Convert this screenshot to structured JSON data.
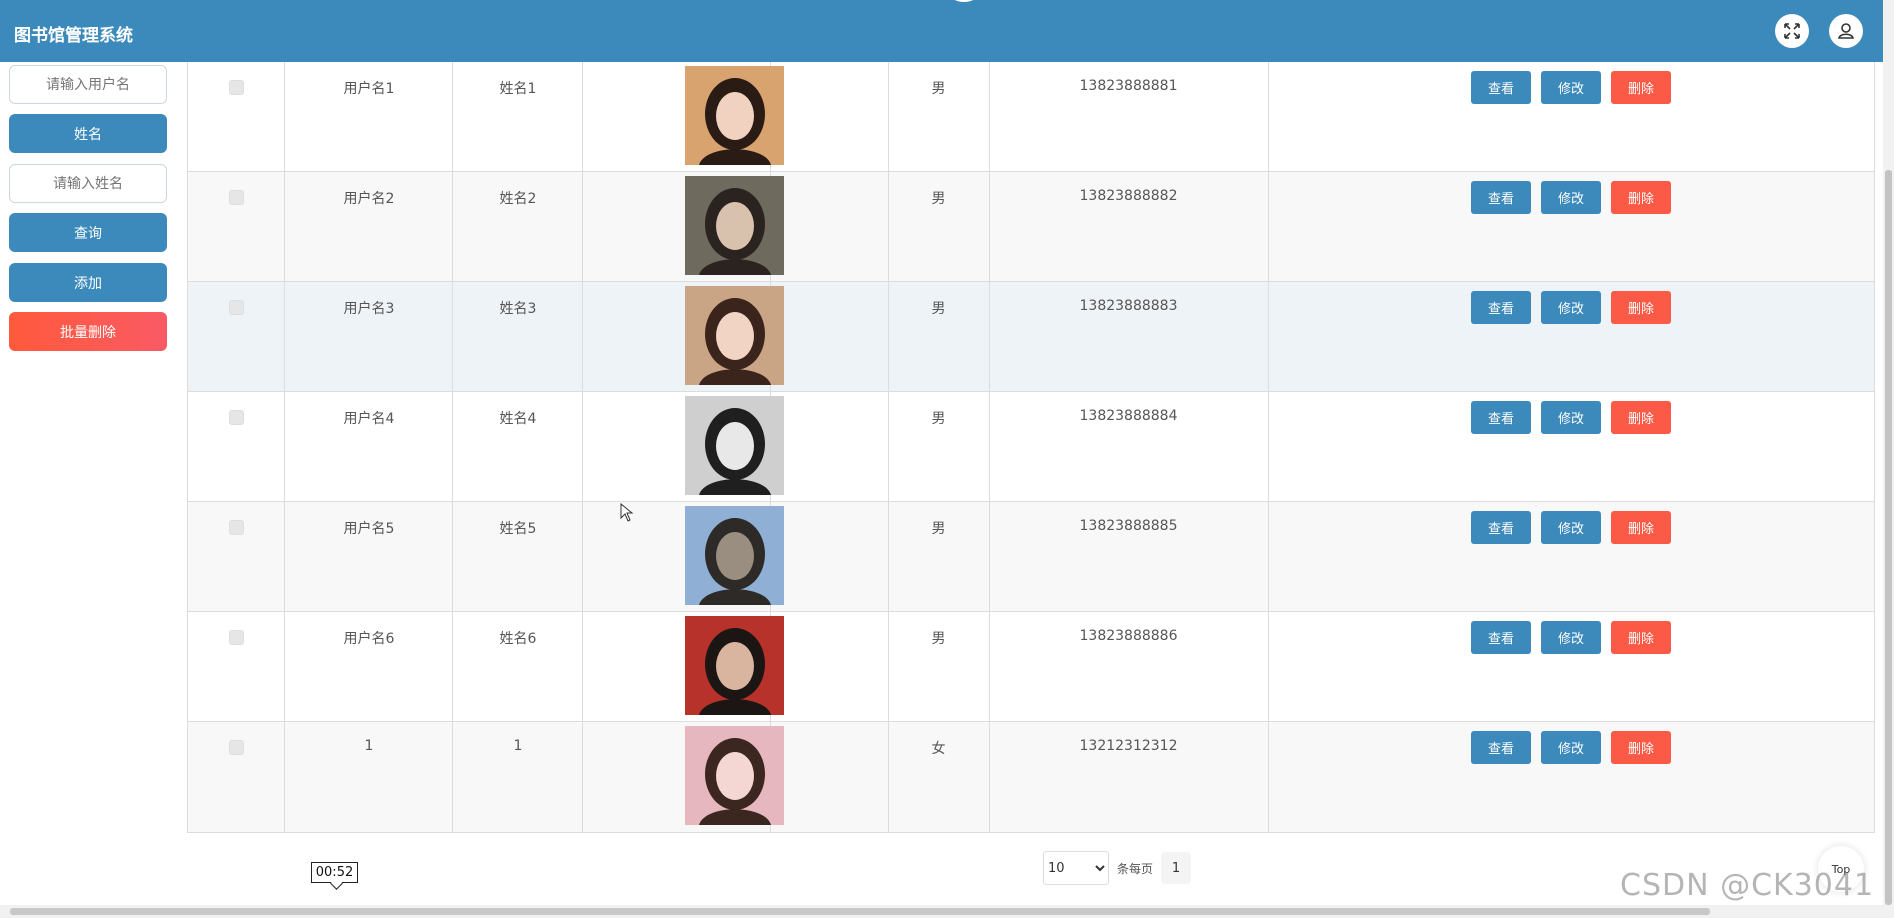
{
  "header": {
    "title": "图书馆管理系统",
    "fullscreen_icon": "fullscreen-icon",
    "user_icon": "user-icon"
  },
  "sidebar": {
    "username_placeholder": "请输入用户名",
    "name_label": "姓名",
    "name_placeholder": "请输入姓名",
    "search_label": "查询",
    "add_label": "添加",
    "batch_delete_label": "批量删除"
  },
  "actions": {
    "view": "查看",
    "edit": "修改",
    "delete": "删除"
  },
  "rows": [
    {
      "username": "用户名1",
      "name": "姓名1",
      "gender": "男",
      "phone": "13823888881"
    },
    {
      "username": "用户名2",
      "name": "姓名2",
      "gender": "男",
      "phone": "13823888882"
    },
    {
      "username": "用户名3",
      "name": "姓名3",
      "gender": "男",
      "phone": "13823888883"
    },
    {
      "username": "用户名4",
      "name": "姓名4",
      "gender": "男",
      "phone": "13823888884"
    },
    {
      "username": "用户名5",
      "name": "姓名5",
      "gender": "男",
      "phone": "13823888885"
    },
    {
      "username": "用户名6",
      "name": "姓名6",
      "gender": "男",
      "phone": "13823888886"
    },
    {
      "username": "1",
      "name": "1",
      "gender": "女",
      "phone": "13212312312"
    }
  ],
  "pagination": {
    "page_size": "10",
    "page_size_options": [
      "10"
    ],
    "per_page_label": "条每页",
    "current_page": "1"
  },
  "overlay": {
    "timer": "00:52",
    "top_label": "Top",
    "watermark": "CSDN @CK3041"
  },
  "colors": {
    "primary": "#3c89bc",
    "danger": "#fa5a46"
  }
}
